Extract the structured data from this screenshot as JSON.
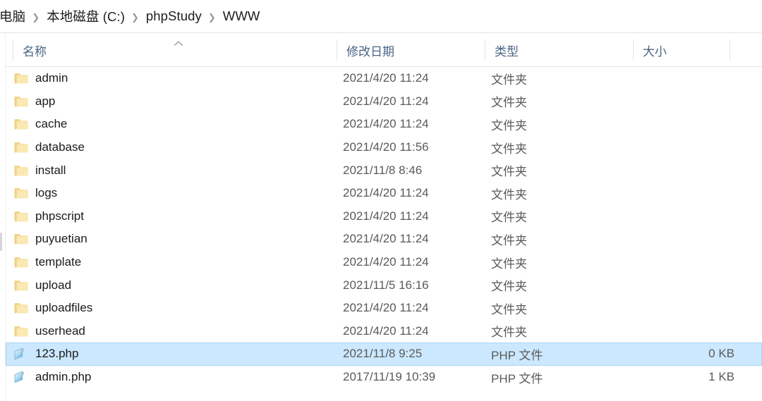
{
  "window": {
    "title": "WWW"
  },
  "breadcrumb": {
    "separator": "❯",
    "items": [
      {
        "label": "电脑"
      },
      {
        "label": "本地磁盘 (C:)"
      },
      {
        "label": "phpStudy"
      },
      {
        "label": "WWW"
      }
    ]
  },
  "columns": {
    "name": "名称",
    "date": "修改日期",
    "type": "类型",
    "size": "大小",
    "sort_column": "名称",
    "sort_direction": "ascending",
    "sort_indicator_icon": "chevron-up-icon"
  },
  "colors": {
    "selection_fill": "#cce8ff",
    "selection_border": "#a8d4f2",
    "header_text": "#4a6484",
    "folder_icon": "#f6dd9b",
    "php_icon": "#9fd3ef"
  },
  "rows": [
    {
      "name": "admin",
      "date": "2021/4/20 11:24",
      "type": "文件夹",
      "size": "",
      "icon": "folder-icon",
      "selected": false
    },
    {
      "name": "app",
      "date": "2021/4/20 11:24",
      "type": "文件夹",
      "size": "",
      "icon": "folder-icon",
      "selected": false
    },
    {
      "name": "cache",
      "date": "2021/4/20 11:24",
      "type": "文件夹",
      "size": "",
      "icon": "folder-icon",
      "selected": false
    },
    {
      "name": "database",
      "date": "2021/4/20 11:56",
      "type": "文件夹",
      "size": "",
      "icon": "folder-icon",
      "selected": false
    },
    {
      "name": "install",
      "date": "2021/11/8 8:46",
      "type": "文件夹",
      "size": "",
      "icon": "folder-icon",
      "selected": false
    },
    {
      "name": "logs",
      "date": "2021/4/20 11:24",
      "type": "文件夹",
      "size": "",
      "icon": "folder-icon",
      "selected": false
    },
    {
      "name": "phpscript",
      "date": "2021/4/20 11:24",
      "type": "文件夹",
      "size": "",
      "icon": "folder-icon",
      "selected": false
    },
    {
      "name": "puyuetian",
      "date": "2021/4/20 11:24",
      "type": "文件夹",
      "size": "",
      "icon": "folder-icon",
      "selected": false
    },
    {
      "name": "template",
      "date": "2021/4/20 11:24",
      "type": "文件夹",
      "size": "",
      "icon": "folder-icon",
      "selected": false
    },
    {
      "name": "upload",
      "date": "2021/11/5 16:16",
      "type": "文件夹",
      "size": "",
      "icon": "folder-icon",
      "selected": false
    },
    {
      "name": "uploadfiles",
      "date": "2021/4/20 11:24",
      "type": "文件夹",
      "size": "",
      "icon": "folder-icon",
      "selected": false
    },
    {
      "name": "userhead",
      "date": "2021/4/20 11:24",
      "type": "文件夹",
      "size": "",
      "icon": "folder-icon",
      "selected": false
    },
    {
      "name": "123.php",
      "date": "2021/11/8 9:25",
      "type": "PHP 文件",
      "size": "0 KB",
      "icon": "php-file-icon",
      "selected": true
    },
    {
      "name": "admin.php",
      "date": "2017/11/19 10:39",
      "type": "PHP 文件",
      "size": "1 KB",
      "icon": "php-file-icon",
      "selected": false
    }
  ]
}
